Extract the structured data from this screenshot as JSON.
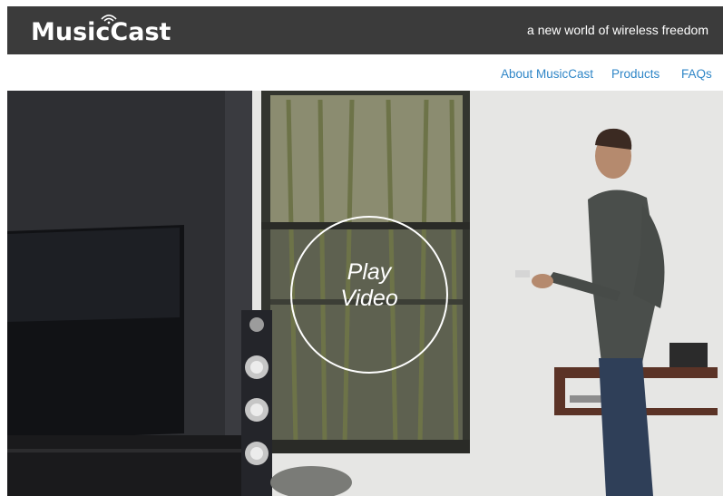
{
  "header": {
    "logo_text": "MusicCast",
    "tagline": "a new world of wireless freedom"
  },
  "nav": {
    "items": [
      {
        "label": "About MusicCast"
      },
      {
        "label": "Products"
      },
      {
        "label": "FAQs"
      }
    ]
  },
  "hero": {
    "play_line1": "Play",
    "play_line2": "Video"
  },
  "colors": {
    "header_bg": "#3b3b3b",
    "nav_link": "#2f86c7"
  }
}
